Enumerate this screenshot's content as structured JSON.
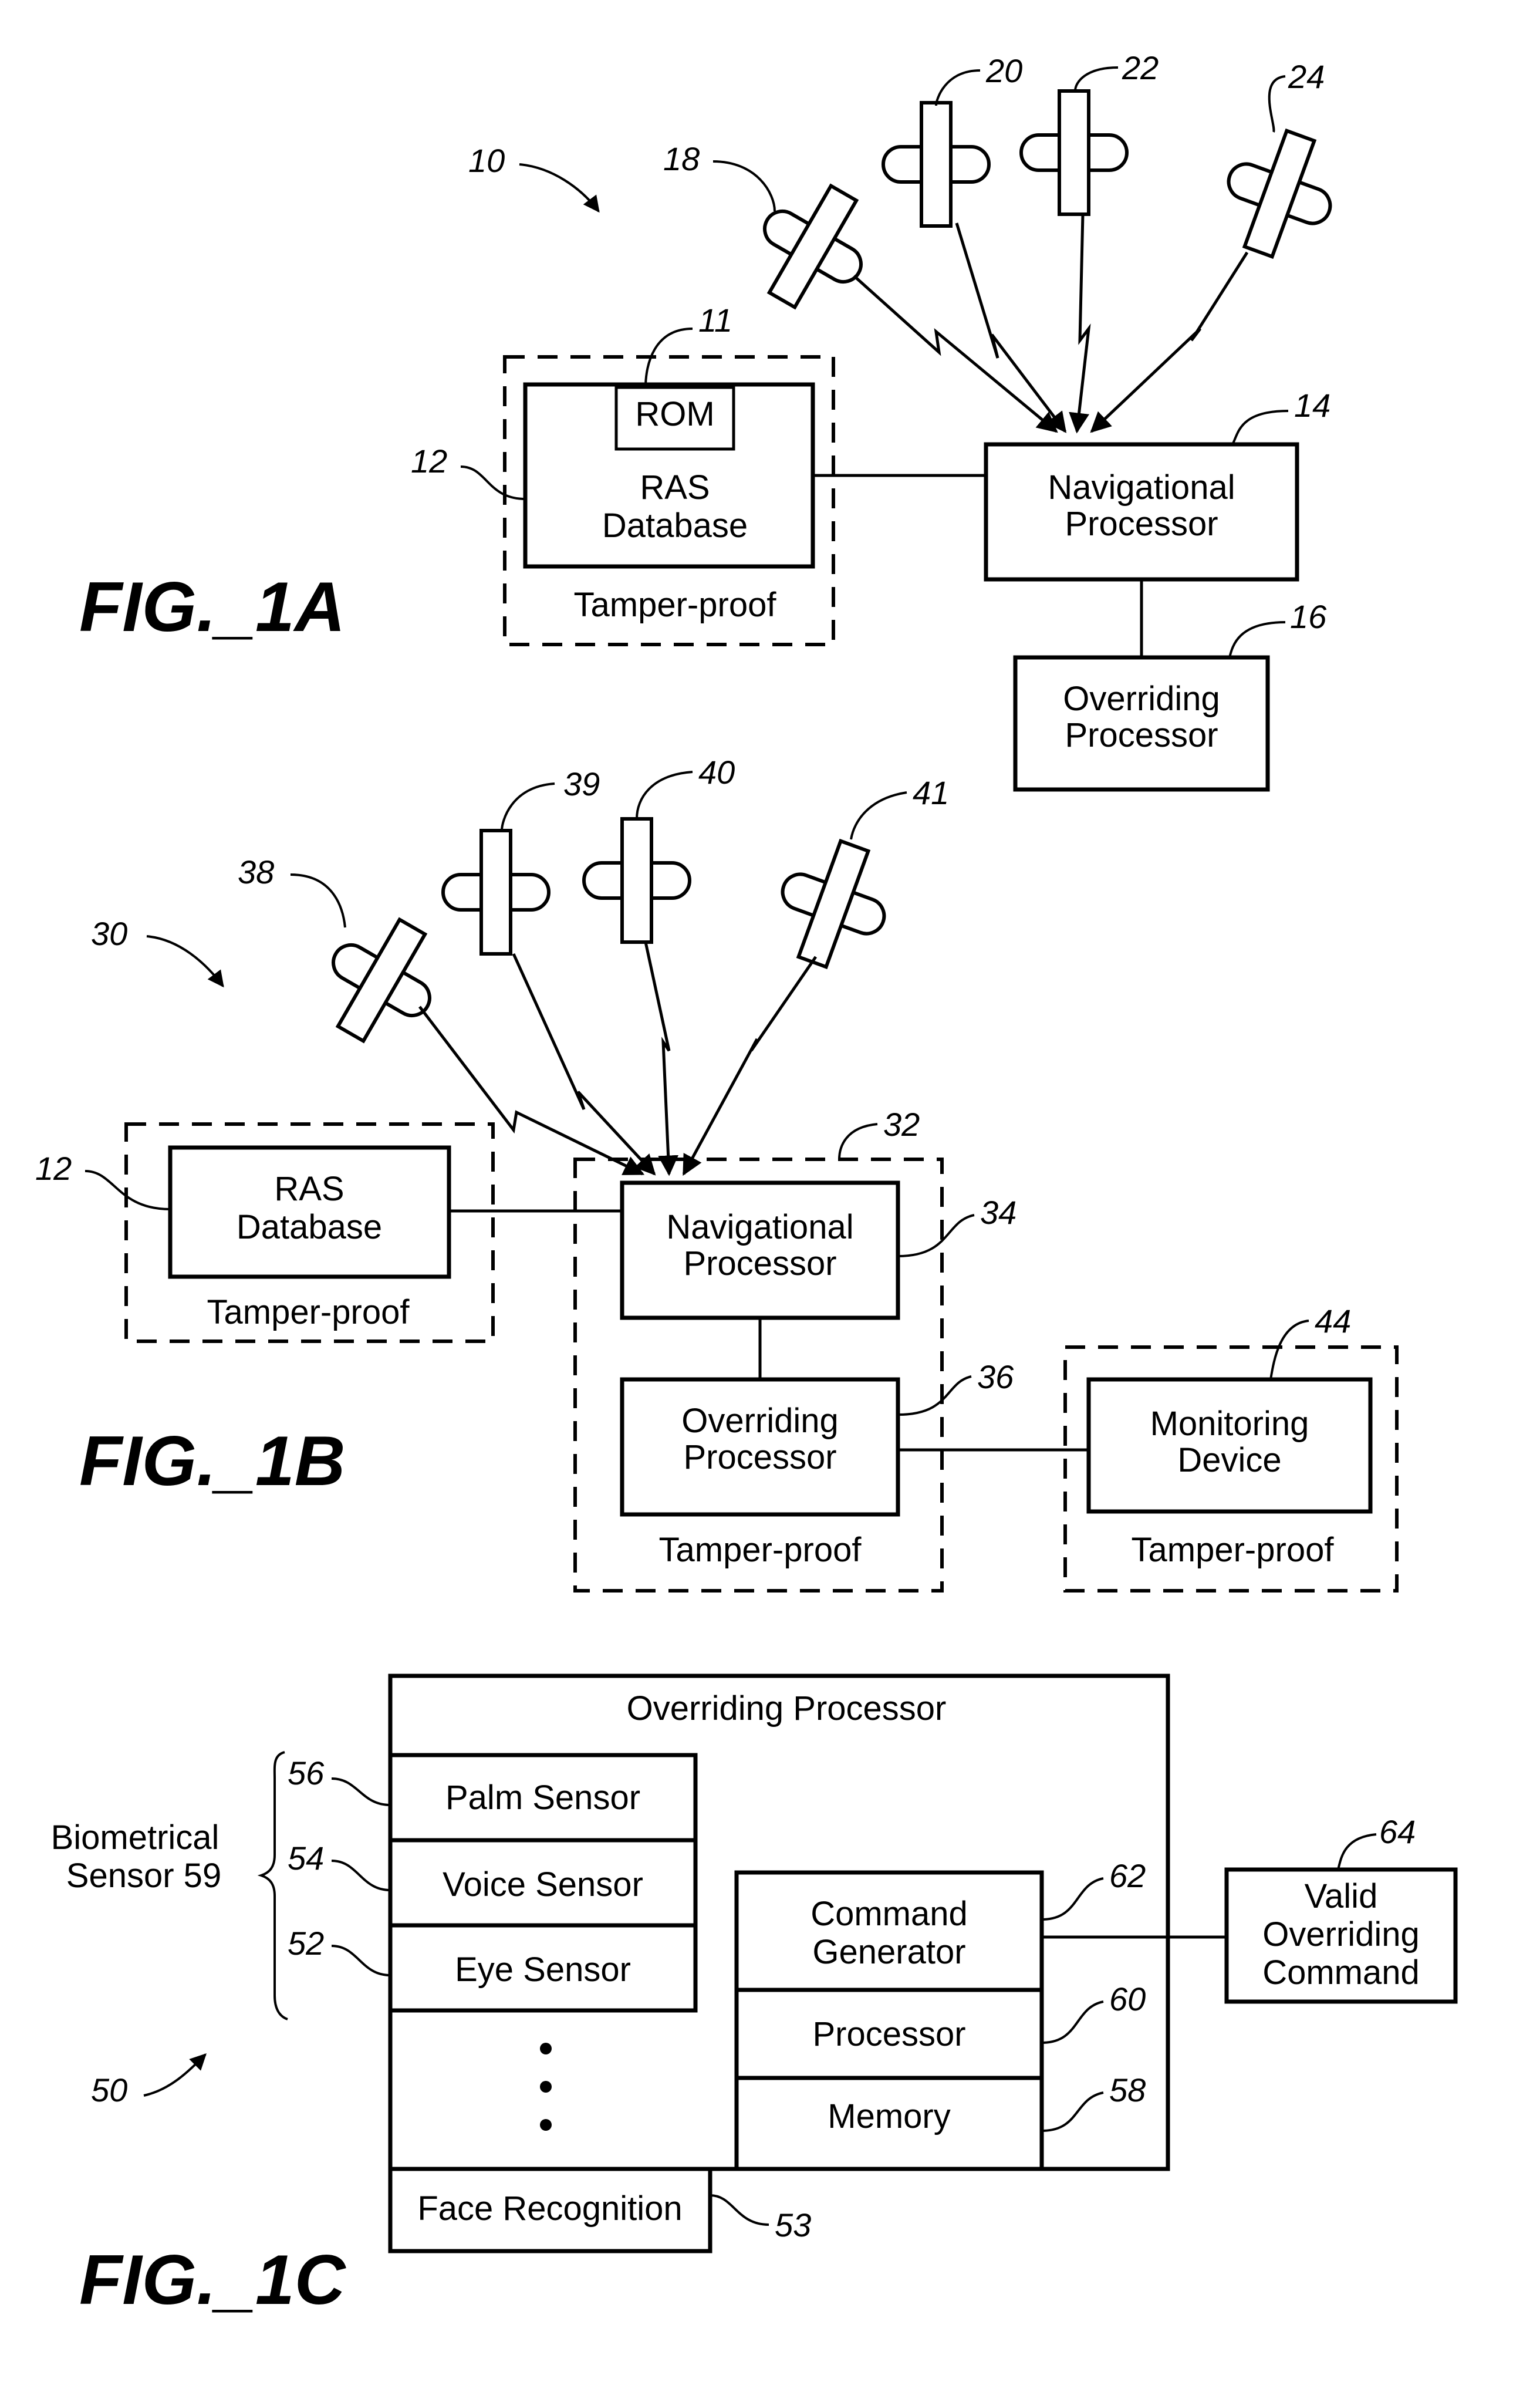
{
  "fig1a": {
    "caption": "FIG._1A",
    "ref_system": "10",
    "ref_rom": "11",
    "ref_ras": "12",
    "ref_nav": "14",
    "ref_override": "16",
    "satellites": [
      "18",
      "20",
      "22",
      "24"
    ],
    "rom_label": "ROM",
    "ras_line1": "RAS",
    "ras_line2": "Database",
    "tamper_label": "Tamper-proof",
    "nav_line1": "Navigational",
    "nav_line2": "Processor",
    "ovr_line1": "Overriding",
    "ovr_line2": "Processor"
  },
  "fig1b": {
    "caption": "FIG._1B",
    "ref_system": "30",
    "ref_ras": "12",
    "ref_group": "32",
    "ref_nav": "34",
    "ref_override": "36",
    "ref_monitor": "44",
    "satellites": [
      "38",
      "39",
      "40",
      "41"
    ],
    "ras_line1": "RAS",
    "ras_line2": "Database",
    "tamper_label": "Tamper-proof",
    "nav_line1": "Navigational",
    "nav_line2": "Processor",
    "ovr_line1": "Overriding",
    "ovr_line2": "Processor",
    "mon_line1": "Monitoring",
    "mon_line2": "Device"
  },
  "fig1c": {
    "caption": "FIG._1C",
    "ref_system": "50",
    "title": "Overriding Processor",
    "bio_line1": "Biometrical",
    "bio_line2": "Sensor 59",
    "sensors": [
      {
        "ref": "56",
        "label": "Palm Sensor"
      },
      {
        "ref": "54",
        "label": "Voice Sensor"
      },
      {
        "ref": "52",
        "label": "Eye Sensor"
      }
    ],
    "ellipsis": "⋮",
    "face": {
      "ref": "53",
      "label": "Face Recognition"
    },
    "stack": [
      {
        "ref": "62",
        "line1": "Command",
        "line2": "Generator"
      },
      {
        "ref": "60",
        "line1": "Processor"
      },
      {
        "ref": "58",
        "line1": "Memory"
      }
    ],
    "output": {
      "ref": "64",
      "line1": "Valid",
      "line2": "Overriding",
      "line3": "Command"
    }
  }
}
